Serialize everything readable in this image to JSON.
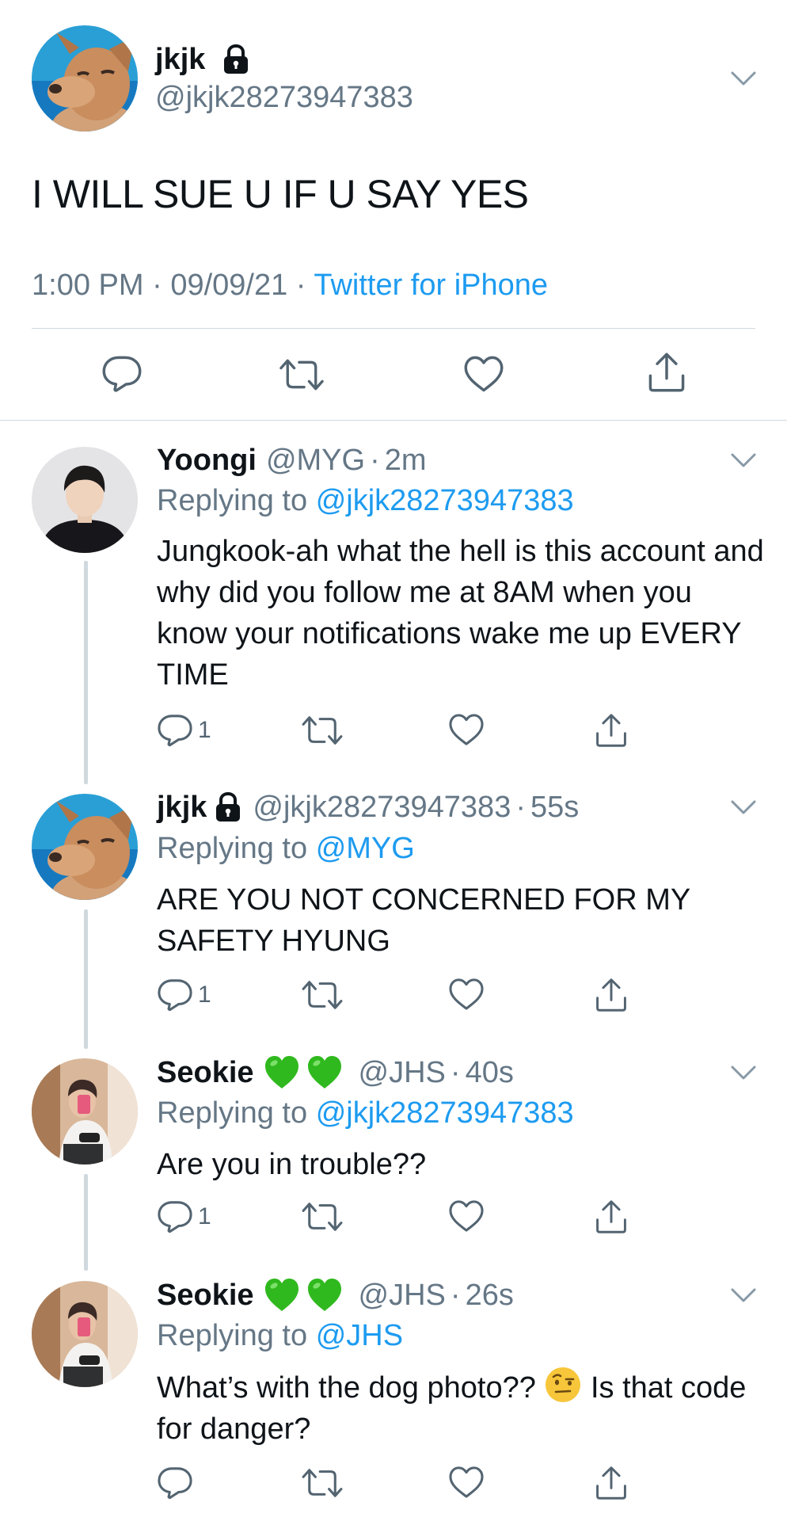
{
  "main_tweet": {
    "display_name": "jkjk",
    "handle": "@jkjk28273947383",
    "text": "I WILL SUE U IF U SAY YES",
    "time": "1:00 PM",
    "date": "09/09/21",
    "source": "Twitter for iPhone",
    "sep": "·"
  },
  "replies": [
    {
      "display_name": "Yoongi",
      "handle": "@MYG",
      "age": "2m",
      "replying_prefix": "Replying to",
      "replying_to": "@jkjk28273947383",
      "text": "Jungkook-ah what the hell is this account and why did you follow me at 8AM when you know your notifications wake me up EVERY TIME",
      "reply_count": "1"
    },
    {
      "display_name": "jkjk",
      "handle": "@jkjk28273947383",
      "age": "55s",
      "replying_prefix": "Replying to",
      "replying_to": "@MYG",
      "text": "ARE YOU NOT CONCERNED FOR MY SAFETY HYUNG",
      "reply_count": "1"
    },
    {
      "display_name": "Seokie",
      "handle": "@JHS",
      "age": "40s",
      "replying_prefix": "Replying to",
      "replying_to": "@jkjk28273947383",
      "text": "Are you in trouble??",
      "reply_count": "1"
    },
    {
      "display_name": "Seokie",
      "handle": "@JHS",
      "age": "26s",
      "replying_prefix": "Replying to",
      "replying_to": "@JHS",
      "text_before_emoji": "What’s with the dog photo??",
      "text_after_emoji": "Is that code for danger?",
      "reply_count": ""
    }
  ],
  "icons": {
    "verified_lock": "lock-icon",
    "green_heart": "green-heart-emoji",
    "raised_eyebrow": "face-with-raised-eyebrow-emoji",
    "reply": "reply-icon",
    "retweet": "retweet-icon",
    "like": "heart-icon",
    "share": "share-icon",
    "menu": "chevron-down-icon"
  },
  "colors": {
    "link": "#1d9bf0",
    "secondary_text": "#657786",
    "divider": "#cfd9de",
    "green_heart": "#22b422"
  }
}
